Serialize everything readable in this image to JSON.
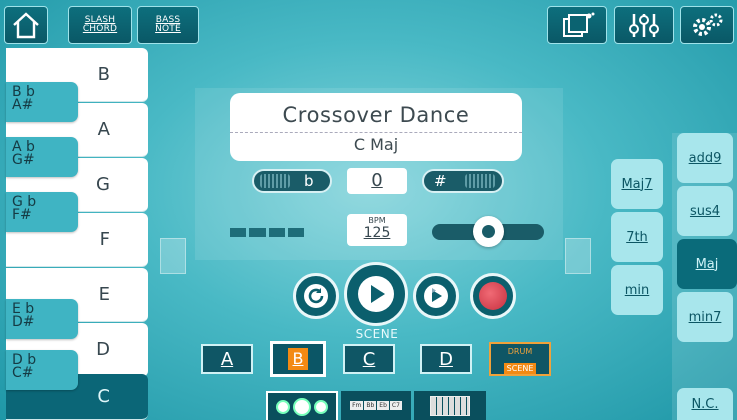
{
  "toolbar": {
    "slash_chord": "SLASH CHORD",
    "bass_note": "BASS NOTE"
  },
  "song": {
    "title": "Crossover Dance",
    "key": "C Maj"
  },
  "transpose": {
    "flat": "b",
    "value": "0",
    "sharp": "#"
  },
  "tempo": {
    "label": "BPM",
    "value": "125"
  },
  "scene": {
    "label": "SCENE",
    "buttons": [
      "A",
      "B",
      "C",
      "D"
    ],
    "drum_label": "DRUM",
    "drum_scene": "SCENE",
    "active": "B"
  },
  "piano": {
    "white_keys": [
      "B",
      "A",
      "G",
      "F",
      "E",
      "D",
      "C"
    ],
    "black_keys": [
      {
        "top": "B b",
        "bottom": "A#"
      },
      {
        "top": "A b",
        "bottom": "G#"
      },
      {
        "top": "G b",
        "bottom": "F#"
      },
      {
        "top": "E b",
        "bottom": "D#"
      },
      {
        "top": "D b",
        "bottom": "C#"
      }
    ],
    "active": "C"
  },
  "chord_quality": {
    "left": [
      "Maj7",
      "7th",
      "Maj",
      "min"
    ],
    "right": [
      "add9",
      "sus4",
      "Maj",
      "min7"
    ],
    "active": "Maj",
    "no_chord": "N.C."
  },
  "bottom_tabs": {
    "chord_chips": [
      "Fm",
      "Bb",
      "Eb",
      "C7"
    ]
  }
}
